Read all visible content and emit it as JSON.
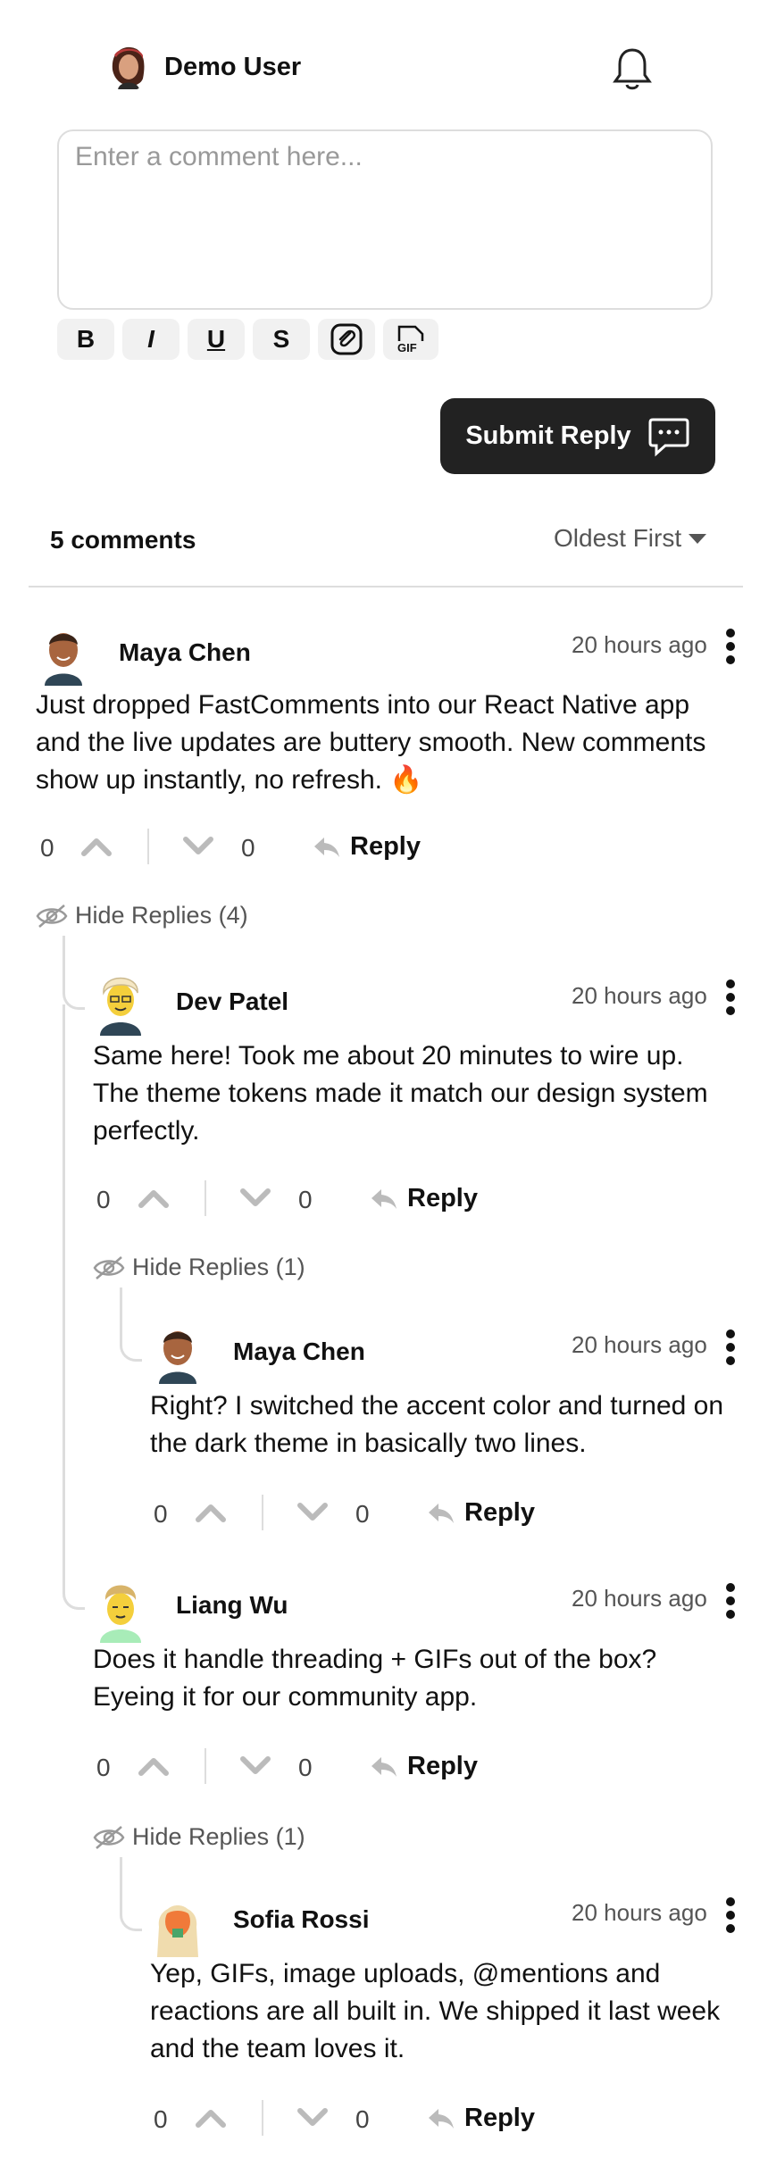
{
  "header": {
    "user_name": "Demo User"
  },
  "composer": {
    "placeholder": "Enter a comment here...",
    "submit_label": "Submit Reply"
  },
  "format_buttons": {
    "bold": "B",
    "italic": "I",
    "underline": "U",
    "strike": "S",
    "gif": "GIF"
  },
  "list": {
    "count_label": "5 comments",
    "sort_label": "Oldest First"
  },
  "comments": [
    {
      "user": "Maya Chen",
      "time": "20 hours ago",
      "text": "Just dropped FastComments into our React Native app and the live updates are buttery smooth. New comments show up instantly, no refresh. 🔥",
      "up": "0",
      "down": "0",
      "reply": "Reply",
      "toggle": "Hide Replies (4)"
    },
    {
      "user": "Dev Patel",
      "time": "20 hours ago",
      "text": "Same here! Took me about 20 minutes to wire up. The theme tokens made it match our design system perfectly.",
      "up": "0",
      "down": "0",
      "reply": "Reply",
      "toggle": "Hide Replies (1)"
    },
    {
      "user": "Maya Chen",
      "time": "20 hours ago",
      "text": "Right? I switched the accent color and turned on the dark theme in basically two lines.",
      "up": "0",
      "down": "0",
      "reply": "Reply"
    },
    {
      "user": "Liang Wu",
      "time": "20 hours ago",
      "text": "Does it handle threading + GIFs out of the box? Eyeing it for our community app.",
      "up": "0",
      "down": "0",
      "reply": "Reply",
      "toggle": "Hide Replies (1)"
    },
    {
      "user": "Sofia Rossi",
      "time": "20 hours ago",
      "text": "Yep, GIFs, image uploads, @mentions and reactions are all built in. We shipped it last week and the team loves it.",
      "up": "0",
      "down": "0",
      "reply": "Reply"
    }
  ]
}
